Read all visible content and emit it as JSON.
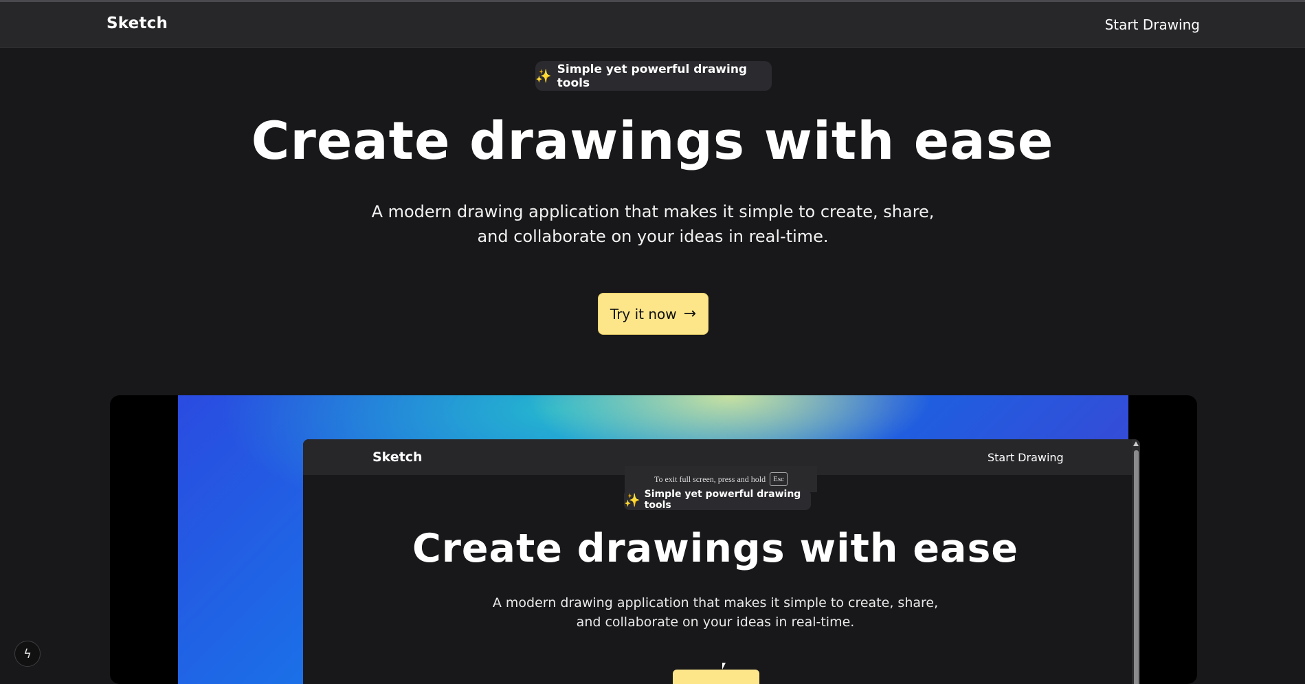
{
  "navbar": {
    "brand": "Sketch",
    "cta": "Start Drawing"
  },
  "hero": {
    "badge_icon": "sparkles-icon",
    "badge_text": "Simple yet powerful drawing tools",
    "title": "Create drawings with ease",
    "subtitle_line1": "A modern drawing application that makes it simple to create, share,",
    "subtitle_line2": "and collaborate on your ideas in real-time.",
    "button_label": "Try it now",
    "button_icon": "arrow-right-icon"
  },
  "preview": {
    "brand": "Sketch",
    "cta": "Start Drawing",
    "fullscreen_notice": "To exit full screen, press and hold",
    "fullscreen_key": "Esc",
    "badge_text": "Simple yet powerful drawing tools",
    "title": "Create drawings with ease",
    "subtitle_line1": "A modern drawing application that makes it simple to create, share,",
    "subtitle_line2": "and collaborate on your ideas in real-time."
  },
  "floating": {
    "icon": "lightning-bolt-icon"
  },
  "colors": {
    "background": "#18181a",
    "navbar": "#27272a",
    "accent": "#fde68a"
  }
}
